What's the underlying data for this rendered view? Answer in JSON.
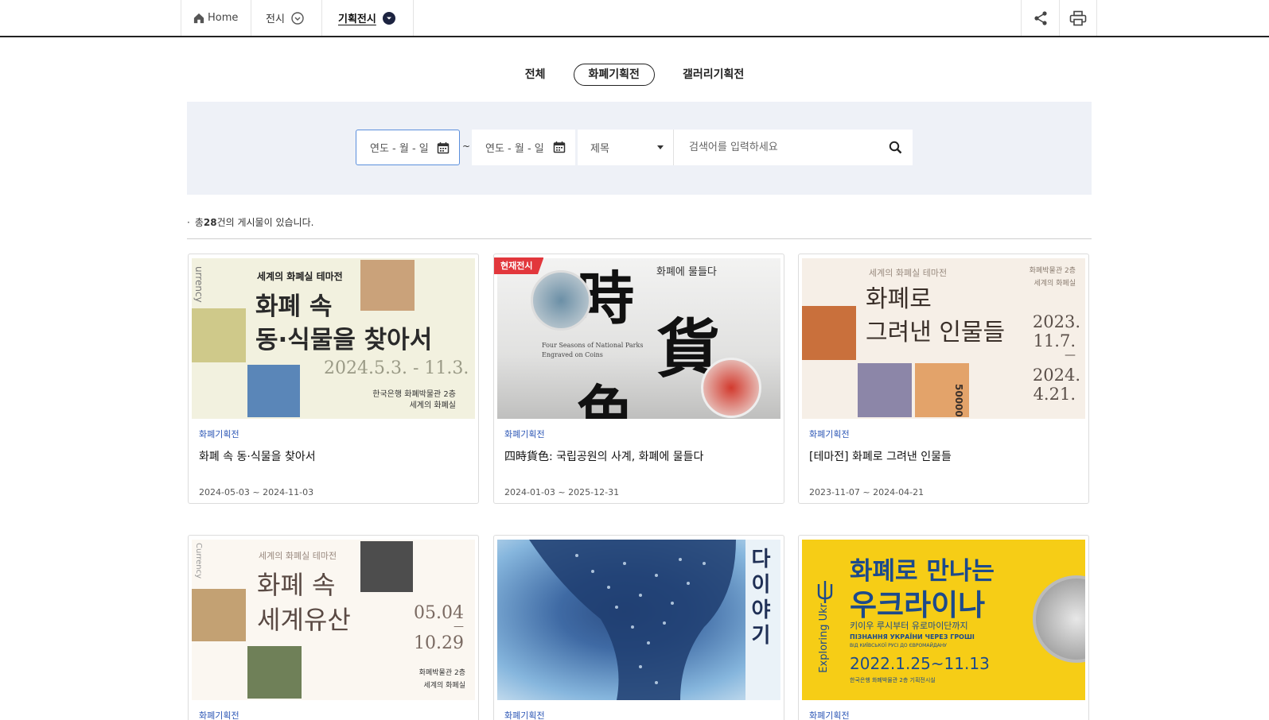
{
  "nav": {
    "home_label": "Home",
    "exhibit_label": "전시",
    "special_label": "기획전시"
  },
  "tabs": [
    {
      "label": "전체",
      "active": false
    },
    {
      "label": "화폐기획전",
      "active": true
    },
    {
      "label": "갤러리기획전",
      "active": false
    }
  ],
  "search": {
    "date_start_value": "연도 - 월 - 일",
    "tilde": "~",
    "date_end_value": "연도 - 월 - 일",
    "field_select_value": "제목",
    "keyword_placeholder": "검색어를 입력하세요"
  },
  "result": {
    "bullet": "·",
    "prefix": "총",
    "count": "28",
    "suffix": "건의 게시물이 있습니다."
  },
  "cards": [
    {
      "category": "화폐기획전",
      "title": "화폐 속 동·식물을 찾아서",
      "period": "2024-05-03 ~ 2024-11-03",
      "badge": "",
      "poster": {
        "bg": "#f2f1df",
        "top_label": "세계의 화폐실 테마전",
        "headline_1": "화폐 속",
        "headline_2": "동·식물을 찾아서",
        "dates": "2024.5.3. - 11.3.",
        "venue_1": "한국은행 화폐박물관 2층",
        "venue_2": "세계의 화폐실",
        "side": "urrency"
      }
    },
    {
      "category": "화폐기획전",
      "title": "四時貨色: 국립공원의 사계, 화폐에 물들다",
      "period": "2024-01-03 ~ 2025-12-31",
      "badge": "현재전시",
      "poster": {
        "bg": "#e7e7e6",
        "top_label": "화폐에 물들다",
        "char_1": "時",
        "char_2": "貨",
        "char_3": "色",
        "caption_1": "Four Seasons of National Parks",
        "caption_2": "Engraved on Coins"
      }
    },
    {
      "category": "화폐기획전",
      "title": "[테마전] 화폐로 그려낸 인물들",
      "period": "2023-11-07 ~ 2024-04-21",
      "badge": "",
      "poster": {
        "bg": "#f6efe7",
        "top_label": "세계의 화폐실 테마전",
        "right_label_1": "화폐박물관 2층",
        "right_label_2": "세계의 화폐실",
        "headline_1": "화폐로",
        "headline_2": "그려낸 인물들",
        "date_1": "2023.",
        "date_2": "11.7.",
        "date_sep": "—",
        "date_3": "2024.",
        "date_4": "4.21.",
        "note": "50000"
      }
    },
    {
      "category": "화폐기획전",
      "title": "",
      "period": "",
      "badge": "",
      "poster": {
        "bg": "#fbf7f1",
        "top_label": "세계의 화폐실 테마전",
        "headline_1": "화폐 속",
        "headline_2": "세계유산",
        "date_1": "05.04",
        "date_sep": "—",
        "date_2": "10.29",
        "venue_1": "화폐박물관 2층",
        "venue_2": "세계의 화폐실",
        "side": "Currency"
      }
    },
    {
      "category": "화폐기획전",
      "title": "",
      "period": "",
      "badge": "",
      "poster": {
        "bg": "#86b6dd",
        "vertical_text": "다이야기"
      }
    },
    {
      "category": "화폐기획전",
      "title": "",
      "period": "",
      "badge": "",
      "poster": {
        "bg": "#f6cd16",
        "headline_1": "화폐로 만나는",
        "headline_2": "우크라이나",
        "sub_1": "키이우 루시부터 유로마이단까지",
        "sub_2": "ПІЗНАННЯ УКРАЇНИ ЧЕРЕЗ ГРОШІ",
        "sub_3": "ВІД КИЇВСЬКОЇ РУСІ ДО ЄВРОМАЙДАНУ",
        "dates": "2022.1.25~11.13",
        "venue": "한국은행 화폐박물관 2층 기획전시실",
        "side": "Exploring Ukr"
      }
    }
  ],
  "colors": {
    "accent_blue": "#2e58b6",
    "badge_red": "#e2373c",
    "search_bg": "#eef1f7"
  }
}
